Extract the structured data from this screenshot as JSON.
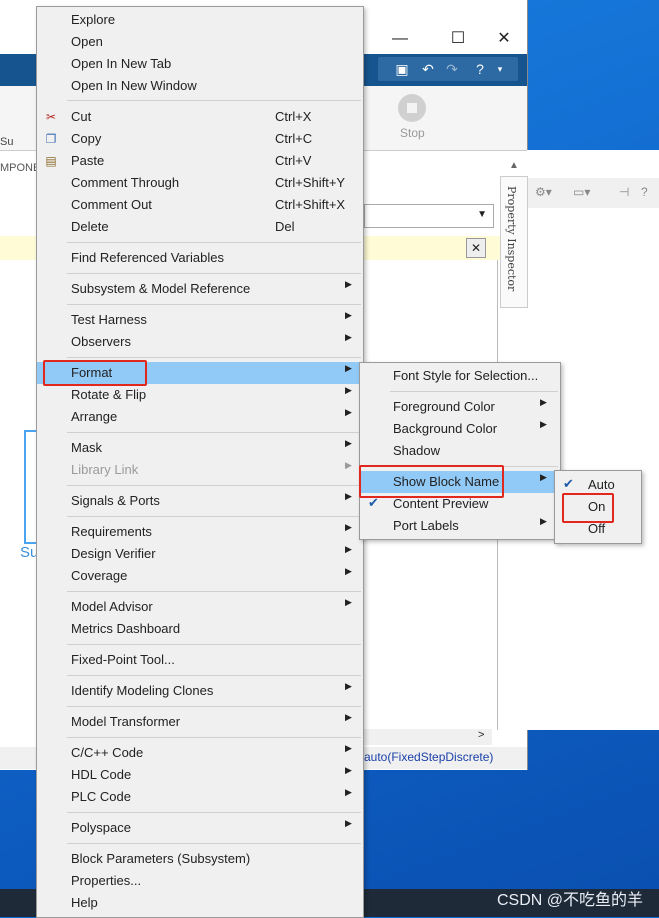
{
  "window": {
    "controls": {
      "minimize": "—",
      "maximize": "☐",
      "close": "✕"
    },
    "ribbon": {
      "stop_label": "Stop",
      "left_fragment_1": "Su",
      "left_fragment_2": "MPONE"
    },
    "quick_access": [
      "save-icon",
      "undo-icon",
      "redo-icon",
      "help-icon"
    ],
    "status_text": "auto(FixedStepDiscrete)",
    "property_inspector": "Property Inspector",
    "block_name_fragment": "Su"
  },
  "context_menu": {
    "items": [
      {
        "label": "Explore"
      },
      {
        "label": "Open"
      },
      {
        "label": "Open In New Tab"
      },
      {
        "label": "Open In New Window"
      },
      {
        "label": "Cut",
        "shortcut": "Ctrl+X",
        "icon": "scissors-icon"
      },
      {
        "label": "Copy",
        "shortcut": "Ctrl+C",
        "icon": "copy-icon"
      },
      {
        "label": "Paste",
        "shortcut": "Ctrl+V",
        "icon": "paste-icon"
      },
      {
        "label": "Comment Through",
        "shortcut": "Ctrl+Shift+Y"
      },
      {
        "label": "Comment Out",
        "shortcut": "Ctrl+Shift+X"
      },
      {
        "label": "Delete",
        "shortcut": "Del"
      },
      {
        "label": "Find Referenced Variables"
      },
      {
        "label": "Subsystem & Model Reference"
      },
      {
        "label": "Test Harness"
      },
      {
        "label": "Observers"
      },
      {
        "label": "Format"
      },
      {
        "label": "Rotate & Flip"
      },
      {
        "label": "Arrange"
      },
      {
        "label": "Mask"
      },
      {
        "label": "Library Link"
      },
      {
        "label": "Signals & Ports"
      },
      {
        "label": "Requirements"
      },
      {
        "label": "Design Verifier"
      },
      {
        "label": "Coverage"
      },
      {
        "label": "Model Advisor"
      },
      {
        "label": "Metrics Dashboard"
      },
      {
        "label": "Fixed-Point Tool..."
      },
      {
        "label": "Identify Modeling Clones"
      },
      {
        "label": "Model Transformer"
      },
      {
        "label": "C/C++ Code"
      },
      {
        "label": "HDL Code"
      },
      {
        "label": "PLC Code"
      },
      {
        "label": "Polyspace"
      },
      {
        "label": "Block Parameters (Subsystem)"
      },
      {
        "label": "Properties..."
      },
      {
        "label": "Help"
      }
    ]
  },
  "format_submenu": {
    "items": [
      {
        "label": "Font Style for Selection..."
      },
      {
        "label": "Foreground Color"
      },
      {
        "label": "Background Color"
      },
      {
        "label": "Shadow"
      },
      {
        "label": "Show Block Name"
      },
      {
        "label": "Content Preview",
        "checked": true
      },
      {
        "label": "Port Labels"
      }
    ]
  },
  "show_block_name_submenu": {
    "items": [
      {
        "label": "Auto",
        "checked": true
      },
      {
        "label": "On"
      },
      {
        "label": "Off"
      }
    ]
  },
  "watermark": "CSDN @不吃鱼的羊",
  "colors": {
    "highlight": "#91c9f7",
    "annotation_red": "#e0281e",
    "titlebar_blue": "#16548f"
  }
}
